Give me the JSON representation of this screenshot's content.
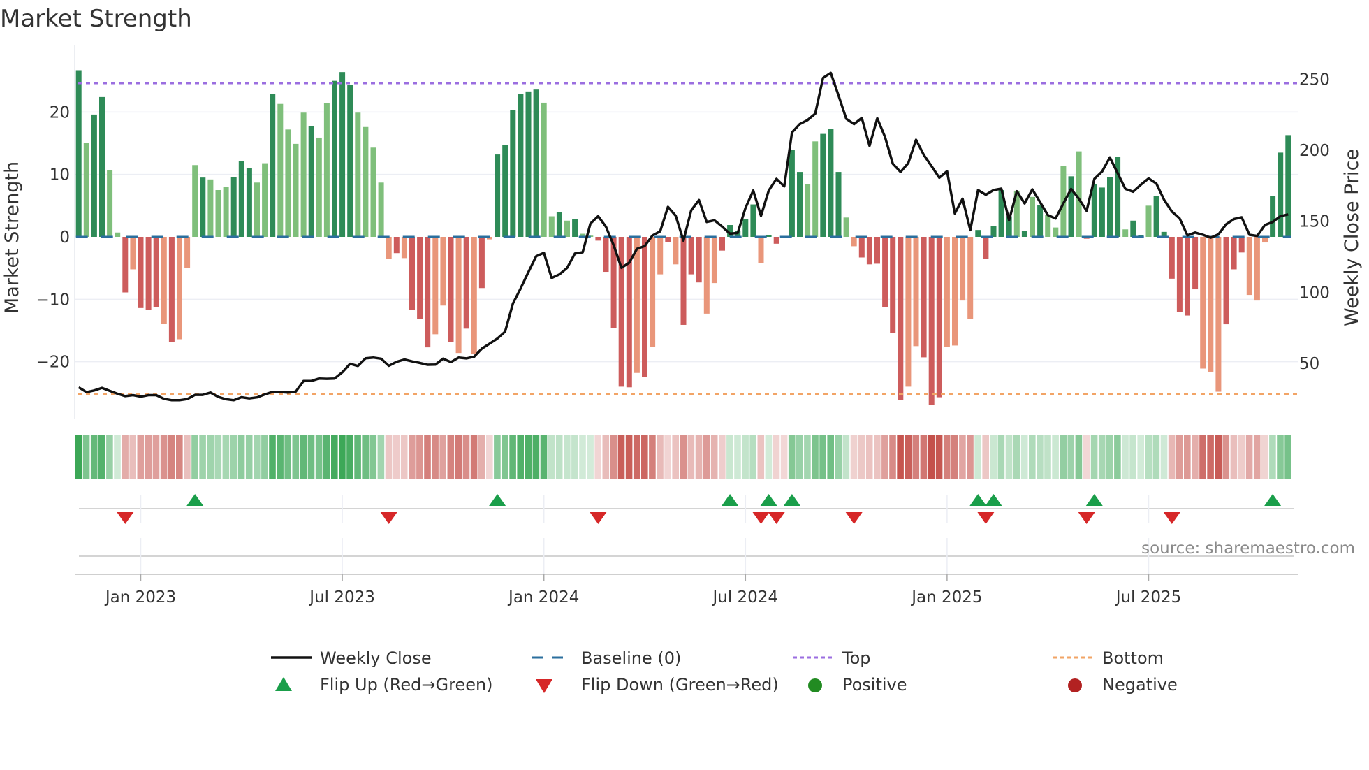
{
  "chart_data": {
    "type": "bar",
    "title": "Market Strength",
    "ylabel": "Market Strength",
    "y2label": "Weekly Close Price",
    "ylim": [
      -29,
      30
    ],
    "y2lim": [
      11,
      271
    ],
    "yticks": [
      {
        "v": 20,
        "label": "20"
      },
      {
        "v": 10,
        "label": "10"
      },
      {
        "v": 0,
        "label": "0"
      },
      {
        "v": -10,
        "label": "−10"
      },
      {
        "v": -20,
        "label": "−20"
      }
    ],
    "y2ticks": [
      {
        "v": 250,
        "label": "250"
      },
      {
        "v": 200,
        "label": "200"
      },
      {
        "v": 150,
        "label": "150"
      },
      {
        "v": 100,
        "label": "100"
      },
      {
        "v": 50,
        "label": "50"
      }
    ],
    "xticks": [
      {
        "week": 9,
        "label": "Jan 2023"
      },
      {
        "week": 35,
        "label": "Jul 2023"
      },
      {
        "week": 61,
        "label": "Jan 2024"
      },
      {
        "week": 87,
        "label": "Jul 2024"
      },
      {
        "week": 113,
        "label": "Jan 2025"
      },
      {
        "week": 139,
        "label": "Jul 2025"
      }
    ],
    "top_level": 24.6,
    "bottom_level": -25.2,
    "baseline": 0,
    "strength": [
      26.7,
      15.1,
      19.6,
      22.4,
      10.7,
      0.7,
      -8.9,
      -5.2,
      -11.4,
      -11.7,
      -11.3,
      -13.9,
      -16.8,
      -16.4,
      -5.0,
      11.5,
      9.5,
      9.2,
      7.5,
      8.0,
      9.6,
      12.2,
      11.0,
      8.7,
      11.8,
      22.9,
      21.3,
      17.2,
      14.9,
      19.9,
      17.7,
      15.9,
      21.4,
      25.0,
      26.4,
      24.3,
      19.9,
      17.6,
      14.3,
      8.7,
      -3.5,
      -2.6,
      -3.4,
      -11.7,
      -13.2,
      -17.7,
      -15.6,
      -11.0,
      -16.9,
      -18.6,
      -14.7,
      -18.7,
      -8.2,
      -0.4,
      13.2,
      14.7,
      20.3,
      22.9,
      23.3,
      23.6,
      21.5,
      3.3,
      4.0,
      2.6,
      2.8,
      0.5,
      0.2,
      -0.6,
      -5.6,
      -14.6,
      -24.0,
      -24.1,
      -21.8,
      -22.5,
      -17.6,
      -6.0,
      -0.8,
      -4.4,
      -14.1,
      -6.0,
      -7.3,
      -12.3,
      -7.4,
      -2.2,
      1.9,
      1.0,
      2.9,
      5.2,
      -4.2,
      0.3,
      -1.1,
      -0.2,
      13.9,
      10.4,
      8.5,
      15.3,
      16.5,
      17.3,
      10.4,
      3.1,
      -1.5,
      -3.3,
      -4.4,
      -4.3,
      -11.2,
      -15.4,
      -26.1,
      -24.0,
      -17.5,
      -19.3,
      -26.9,
      -25.7,
      -17.6,
      -17.4,
      -10.2,
      -13.1,
      1.1,
      -3.5,
      1.7,
      7.5,
      3.3,
      7.4,
      1.0,
      6.4,
      5.1,
      3.5,
      1.5,
      11.4,
      9.7,
      13.7,
      -0.3,
      8.4,
      7.9,
      9.6,
      12.8,
      1.2,
      2.6,
      0.3,
      5.0,
      6.5,
      0.8,
      -6.7,
      -12.0,
      -12.6,
      -8.4,
      -21.1,
      -21.6,
      -24.8,
      -14.0,
      -5.2,
      -2.5,
      -9.3,
      -10.2,
      -0.9,
      6.5,
      13.5,
      16.3
    ],
    "shade": "dlddlldldddldllldllldddlldlllldlldddllllldldddlldldldlddddddlldldlldddddldlldldddlldddddlddlddlldddllddddddlldddlllldddddldldllldldddddlddlddddddllldddllldddd",
    "weekly_close": [
      33,
      29.6,
      30.8,
      32.6,
      30.5,
      28.5,
      26.8,
      27.5,
      26.4,
      27.5,
      27.5,
      24.9,
      23.9,
      23.9,
      24.7,
      27.7,
      27.7,
      29.3,
      26.2,
      24.6,
      23.9,
      26.0,
      25.2,
      25.9,
      28.0,
      29.8,
      29.7,
      29.3,
      30.0,
      37.5,
      37.5,
      39.2,
      39.0,
      39.2,
      43.6,
      49.6,
      48.1,
      53.5,
      54.0,
      53.2,
      48.2,
      51.0,
      52.6,
      51.3,
      50.2,
      48.9,
      49.0,
      53.2,
      50.8,
      54.0,
      53.4,
      54.6,
      60.3,
      63.8,
      67.4,
      72.3,
      92.0,
      102.7,
      114.2,
      125.4,
      127.8,
      110.1,
      112.6,
      117.2,
      127.3,
      128.2,
      148.4,
      153.6,
      146.2,
      133.1,
      117.2,
      120.8,
      130.6,
      132.6,
      140.0,
      142.9,
      160.2,
      153.9,
      136.4,
      157.7,
      165.0,
      149.5,
      150.7,
      146.2,
      141.3,
      141.8,
      159.4,
      171.7,
      153.9,
      171.7,
      179.9,
      174.6,
      212.7,
      218.5,
      221.3,
      225.9,
      251.0,
      254.6,
      238.7,
      222.2,
      218.5,
      222.9,
      203.2,
      222.6,
      209.4,
      190.6,
      184.8,
      191.1,
      207.5,
      196.8,
      188.9,
      180.7,
      185.3,
      155.6,
      165.9,
      143.8,
      172.0,
      168.7,
      172.0,
      173.0,
      150.7,
      171.2,
      162.6,
      172.5,
      163.5,
      154.4,
      152.0,
      162.6,
      172.8,
      165.9,
      157.4,
      179.9,
      185.1,
      195.0,
      184.0,
      172.8,
      170.9,
      175.8,
      180.2,
      176.6,
      165.1,
      156.9,
      152.0,
      140.1,
      142.1,
      140.5,
      138.5,
      140.8,
      147.9,
      151.6,
      152.8,
      140.5,
      139.7,
      147.4,
      149.5,
      153.6,
      154.9
    ],
    "flips_up": [
      16,
      55,
      85,
      90,
      93,
      117,
      119,
      132,
      155
    ],
    "flips_down": [
      7,
      41,
      68,
      89,
      91,
      101,
      118,
      131,
      142
    ],
    "colors": {
      "pos_strong": "#2e8b57",
      "pos_weak": "#7fbf7b",
      "neg_strong": "#cd5c5c",
      "neg_weak": "#e9967a",
      "baseline": "#2b6f9e",
      "top": "#9b6ee0",
      "bottom": "#f2a466",
      "flip_up": "#1a9e4a",
      "flip_down": "#d62728",
      "positive": "#228b22",
      "negative": "#b22222",
      "heat_pos": "#3aa655",
      "heat_neg": "#c4504a"
    },
    "legend": {
      "weekly_close": "Weekly Close",
      "baseline": "Baseline (0)",
      "top": "Top",
      "bottom": "Bottom",
      "flip_up": "Flip Up (Red→Green)",
      "flip_down": "Flip Down (Green→Red)",
      "positive": "Positive",
      "negative": "Negative"
    },
    "source": "source: sharemaestro.com"
  }
}
